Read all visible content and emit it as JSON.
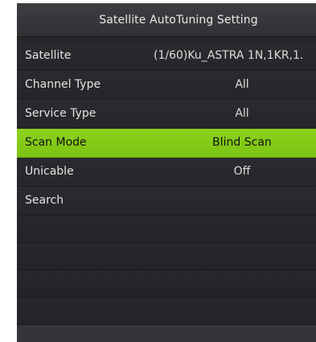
{
  "title": "Satellite AutoTuning Setting",
  "menu": [
    {
      "label": "Satellite",
      "value": "(1/60)Ku_ASTRA 1N,1KR,1."
    },
    {
      "label": "Channel Type",
      "value": "All"
    },
    {
      "label": "Service Type",
      "value": "All"
    },
    {
      "label": "Scan Mode",
      "value": "Blind Scan"
    },
    {
      "label": "Unicable",
      "value": "Off"
    },
    {
      "label": "Search",
      "value": ""
    }
  ],
  "colors": {
    "highlight": "#84cb18",
    "background": "#252628",
    "text": "#e4e4e4"
  }
}
